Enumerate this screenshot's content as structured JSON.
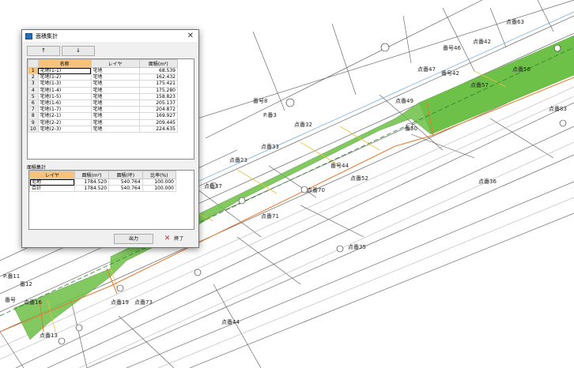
{
  "dialog": {
    "title": "面積集計",
    "up_button": "↑",
    "down_button": "↓",
    "columns": {
      "name": "名称",
      "layer": "レイヤ",
      "area": "面積(m²)"
    },
    "rows": [
      {
        "no": "1",
        "name": "宅地(1-1)",
        "layer": "宅地",
        "area": "68.539"
      },
      {
        "no": "2",
        "name": "宅地(1-2)",
        "layer": "宅地",
        "area": "162.432"
      },
      {
        "no": "3",
        "name": "宅地(1-3)",
        "layer": "宅地",
        "area": "175.421"
      },
      {
        "no": "4",
        "name": "宅地(1-4)",
        "layer": "宅地",
        "area": "175.280"
      },
      {
        "no": "5",
        "name": "宅地(1-5)",
        "layer": "宅地",
        "area": "158.823"
      },
      {
        "no": "6",
        "name": "宅地(1-6)",
        "layer": "宅地",
        "area": "205.137"
      },
      {
        "no": "7",
        "name": "宅地(1-7)",
        "layer": "宅地",
        "area": "204.872"
      },
      {
        "no": "8",
        "name": "宅地(2-1)",
        "layer": "宅地",
        "area": "169.927"
      },
      {
        "no": "9",
        "name": "宅地(2-2)",
        "layer": "宅地",
        "area": "209.445"
      },
      {
        "no": "10",
        "name": "宅地(2-3)",
        "layer": "宅地",
        "area": "224.635"
      }
    ],
    "summary_label": "面積集計",
    "summary_columns": {
      "layer": "レイヤ",
      "area_m2": "面積(m²)",
      "area_tsubo": "面積(坪)",
      "ratio": "比率(%)"
    },
    "summary_rows": [
      {
        "layer": "宅地",
        "area_m2": "1784.520",
        "area_tsubo": "540.764",
        "ratio": "100.000"
      },
      {
        "layer": "合計",
        "area_m2": "1784.520",
        "area_tsubo": "540.764",
        "ratio": "100.000"
      }
    ],
    "output_button": "出力",
    "end_button": "終了",
    "close_icon": "✕"
  },
  "map": {
    "labels": [
      "P.番11",
      "番12",
      "点番13",
      "点番16",
      "番号",
      "点番19",
      "点番73",
      "点番44",
      "点番35",
      "点番36",
      "点番37",
      "点番63",
      "番号8",
      "番号44",
      "番50",
      "点番52",
      "点番70",
      "点番71",
      "点番33",
      "番号46",
      "点番47",
      "点番49",
      "点番56",
      "点番57",
      "番号42",
      "点番42",
      "点番23",
      "点番32",
      "点番83",
      "P.番3"
    ],
    "colors": {
      "parcel_fill": "#6cc046",
      "parcel_line": "#e8762c",
      "road_line": "#3b8c3b"
    }
  }
}
